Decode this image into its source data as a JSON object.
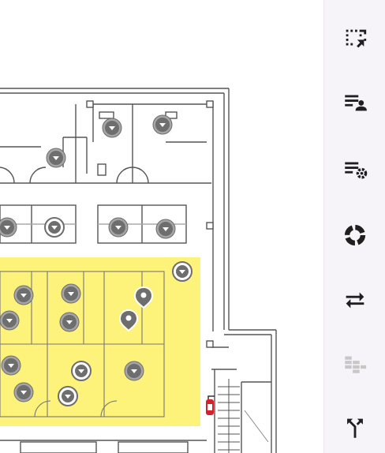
{
  "colors": {
    "highlight": "#fdf27a",
    "marker": "#6e6e6e",
    "marker_outline": "#a5a5a5",
    "icon": "#1f1f1f",
    "icon_disabled": "#c7c7c7",
    "toolbar_bg": "#f7f4f9",
    "wall": "#555555",
    "extinguisher": "#d6202a"
  },
  "map": {
    "markers": [
      {
        "kind": "person"
      },
      {
        "kind": "person"
      },
      {
        "kind": "person"
      },
      {
        "kind": "person"
      },
      {
        "kind": "person-selected"
      },
      {
        "kind": "person"
      },
      {
        "kind": "person"
      },
      {
        "kind": "person-selected"
      },
      {
        "kind": "person"
      },
      {
        "kind": "person"
      },
      {
        "kind": "person"
      },
      {
        "kind": "location-pin"
      },
      {
        "kind": "location-pin"
      },
      {
        "kind": "person"
      },
      {
        "kind": "person"
      },
      {
        "kind": "person-selected"
      },
      {
        "kind": "person"
      },
      {
        "kind": "person"
      },
      {
        "kind": "person-selected"
      }
    ],
    "extinguisher_icon": "fire-extinguisher-icon"
  },
  "toolbar": {
    "tools": [
      {
        "icon": "select-area-icon",
        "enabled": true
      },
      {
        "icon": "list-person-icon",
        "enabled": true
      },
      {
        "icon": "list-settings-icon",
        "enabled": true
      },
      {
        "icon": "donut-icon",
        "enabled": true
      },
      {
        "icon": "swap-icon",
        "enabled": true
      },
      {
        "icon": "stack-icon",
        "enabled": false
      },
      {
        "icon": "merge-arrow-icon",
        "enabled": true
      }
    ]
  }
}
